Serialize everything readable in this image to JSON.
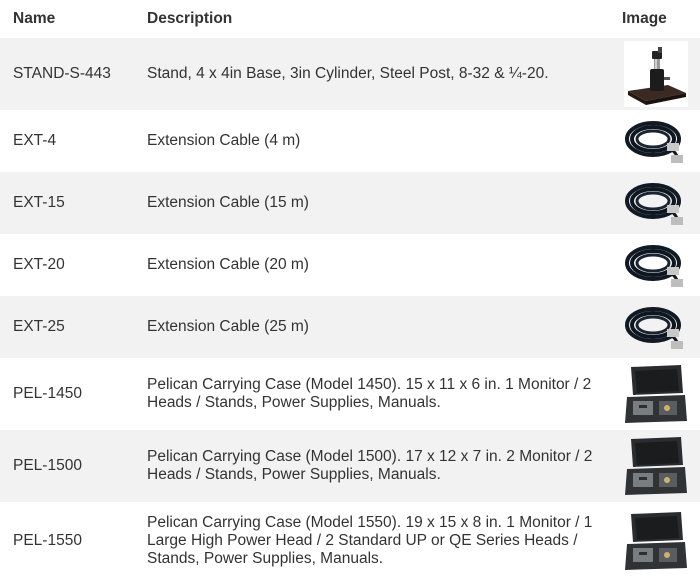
{
  "table": {
    "headers": {
      "name": "Name",
      "description": "Description",
      "image": "Image"
    },
    "rows": [
      {
        "name": "STAND-S-443",
        "description": "Stand, 4 x 4in Base, 3in Cylinder, Steel Post, 8-32 & ¼-20.",
        "image_icon": "stand-product-image"
      },
      {
        "name": "EXT-4",
        "description": "Extension Cable (4 m)",
        "image_icon": "cable-product-image"
      },
      {
        "name": "EXT-15",
        "description": "Extension Cable (15 m)",
        "image_icon": "cable-product-image"
      },
      {
        "name": "EXT-20",
        "description": "Extension Cable (20 m)",
        "image_icon": "cable-product-image"
      },
      {
        "name": "EXT-25",
        "description": "Extension Cable (25 m)",
        "image_icon": "cable-product-image"
      },
      {
        "name": "PEL-1450",
        "description": "Pelican Carrying Case (Model 1450). 15 x 11 x 6 in. 1 Monitor / 2 Heads / Stands, Power Supplies, Manuals.",
        "image_icon": "case-product-image"
      },
      {
        "name": "PEL-1500",
        "description": "Pelican Carrying Case (Model 1500). 17 x 12 x 7 in. 2 Monitor / 2 Heads / Stands, Power Supplies, Manuals.",
        "image_icon": "case-product-image"
      },
      {
        "name": "PEL-1550",
        "description": "Pelican Carrying Case (Model 1550). 19 x 15 x 8 in. 1 Monitor / 1 Large High Power Head / 2 Standard UP or QE Series Heads / Stands, Power Supplies, Manuals.",
        "image_icon": "case-product-image"
      }
    ]
  },
  "colors": {
    "row_alt_bg": "#f2f2f2",
    "text": "#333333"
  }
}
